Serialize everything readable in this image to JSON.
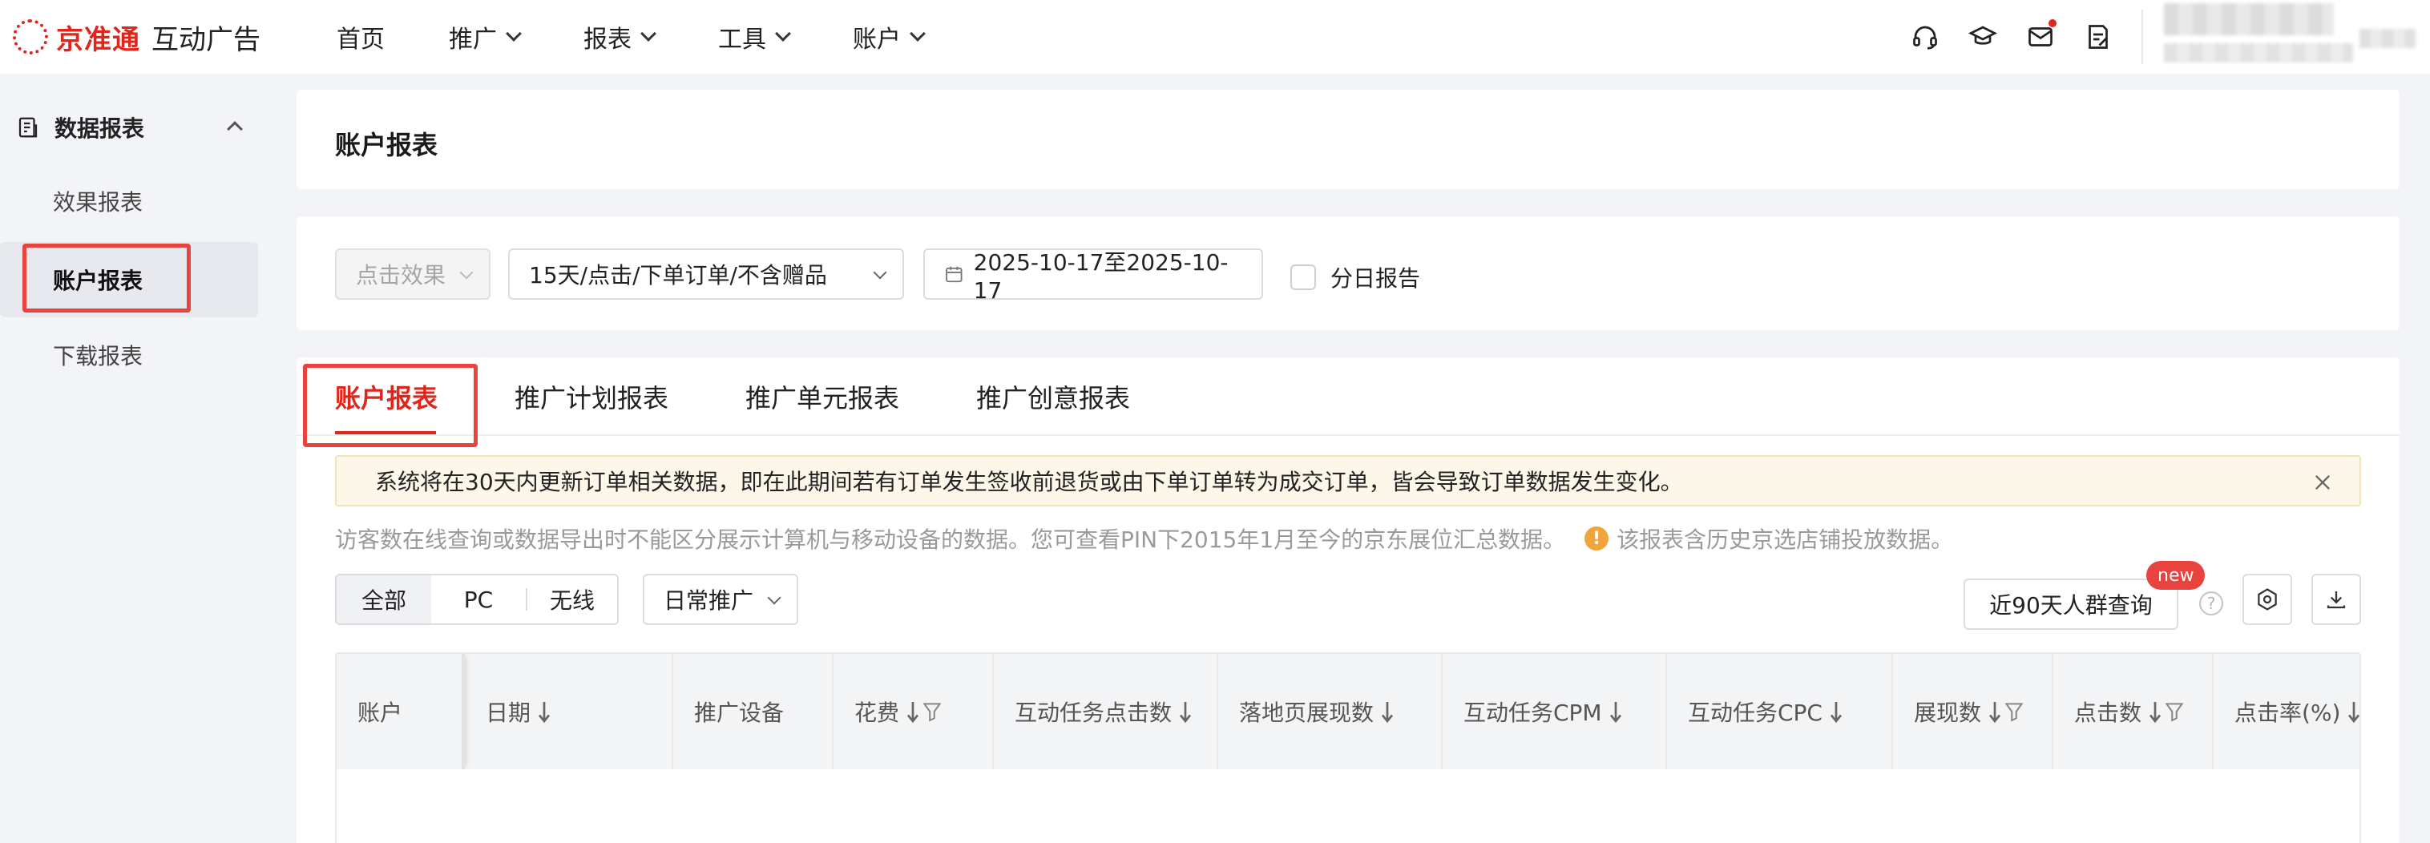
{
  "header": {
    "brand": "京准通",
    "product": "互动广告",
    "nav": [
      {
        "label": "首页",
        "has_menu": false
      },
      {
        "label": "推广",
        "has_menu": true
      },
      {
        "label": "报表",
        "has_menu": true
      },
      {
        "label": "工具",
        "has_menu": true
      },
      {
        "label": "账户",
        "has_menu": true
      }
    ],
    "icons": [
      "headset-icon",
      "graduation-cap-icon",
      "mail-icon",
      "task-icon"
    ],
    "accent_color": "#e1251b"
  },
  "sidebar": {
    "section_title": "数据报表",
    "items": [
      {
        "label": "效果报表",
        "active": false
      },
      {
        "label": "账户报表",
        "active": true
      },
      {
        "label": "下载报表",
        "active": false
      }
    ]
  },
  "page": {
    "title": "账户报表"
  },
  "filters": {
    "effect_select": "点击效果",
    "attribution_select": "15天/点击/下单订单/不含赠品",
    "date_range": "2025-10-17至2025-10-17",
    "daily_report_label": "分日报告",
    "daily_report_checked": false
  },
  "tabs": [
    {
      "label": "账户报表",
      "active": true
    },
    {
      "label": "推广计划报表",
      "active": false
    },
    {
      "label": "推广单元报表",
      "active": false
    },
    {
      "label": "推广创意报表",
      "active": false
    }
  ],
  "notice": {
    "text": "系统将在30天内更新订单相关数据，即在此期间若有订单发生签收前退货或由下单订单转为成交订单，皆会导致订单数据发生变化。"
  },
  "hint": {
    "text": "访客数在线查询或数据导出时不能区分展示计算机与移动设备的数据。您可查看PIN下2015年1月至今的京东展位汇总数据。",
    "warn_text": "该报表含历史京选店铺投放数据。"
  },
  "device_segment": {
    "options": [
      {
        "label": "全部",
        "active": true
      },
      {
        "label": "PC",
        "active": false
      },
      {
        "label": "无线",
        "active": false
      }
    ]
  },
  "promo_type_select": "日常推广",
  "crowd_query": {
    "label": "近90天人群查询",
    "badge": "new"
  },
  "table": {
    "columns": [
      {
        "label": "账户",
        "sortable": false,
        "filterable": false
      },
      {
        "label": "日期",
        "sortable": true,
        "filterable": false
      },
      {
        "label": "推广设备",
        "sortable": false,
        "filterable": false
      },
      {
        "label": "花费",
        "sortable": true,
        "filterable": true
      },
      {
        "label": "互动任务点击数",
        "sortable": true,
        "filterable": false
      },
      {
        "label": "落地页展现数",
        "sortable": true,
        "filterable": false
      },
      {
        "label": "互动任务CPM",
        "sortable": true,
        "filterable": false
      },
      {
        "label": "互动任务CPC",
        "sortable": true,
        "filterable": false
      },
      {
        "label": "展现数",
        "sortable": true,
        "filterable": true
      },
      {
        "label": "点击数",
        "sortable": true,
        "filterable": true
      },
      {
        "label": "点击率(%)",
        "sortable": true,
        "filterable": false
      }
    ]
  }
}
